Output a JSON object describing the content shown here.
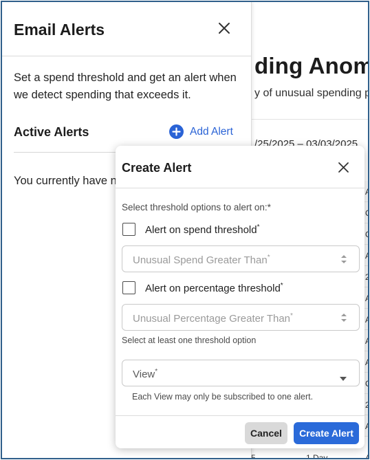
{
  "background": {
    "title": "ding Anoma",
    "subtitle": "y of unusual spending p",
    "date_range": "/25/2025 – 03/03/2025",
    "column_cells": [
      "A",
      "C",
      "C",
      "A",
      "2",
      "A",
      "A",
      "A",
      "A",
      "C",
      "2",
      "A"
    ],
    "bottom_cells": [
      "5",
      "1 Day",
      "A"
    ]
  },
  "drawer": {
    "title": "Email Alerts",
    "description": "Set a spend threshold and get an alert when we detect spending that exceeds it.",
    "active_title": "Active Alerts",
    "add_alert_label": "Add Alert",
    "empty_text": "You currently have n"
  },
  "modal": {
    "title": "Create Alert",
    "select_label": "Select threshold options to alert on:*",
    "spend_checkbox": {
      "label": "Alert on spend threshold",
      "required_mark": "*",
      "checked": false
    },
    "spend_input": {
      "placeholder": "Unusual Spend Greater Than",
      "required_mark": "*"
    },
    "percentage_checkbox": {
      "label": "Alert on percentage threshold",
      "required_mark": "*",
      "checked": false
    },
    "percentage_input": {
      "placeholder": "Unusual Percentage Greater Than",
      "required_mark": "*"
    },
    "helper_text": "Select at least one threshold option",
    "view_select": {
      "label": "View",
      "required_mark": "*"
    },
    "view_note": "Each View may only be subscribed to one alert.",
    "cancel_label": "Cancel",
    "create_label": "Create Alert"
  },
  "colors": {
    "accent": "#2a6ad9",
    "link": "#2a63d6",
    "frame_border": "#2f5f8a",
    "cancel_bg": "#d9d9d9"
  },
  "icons": {
    "drawer_close": "close-icon",
    "add_alert": "plus-circle-icon",
    "modal_close": "close-icon",
    "spinner": "spinner-arrows-icon",
    "select_caret": "caret-down-icon"
  }
}
